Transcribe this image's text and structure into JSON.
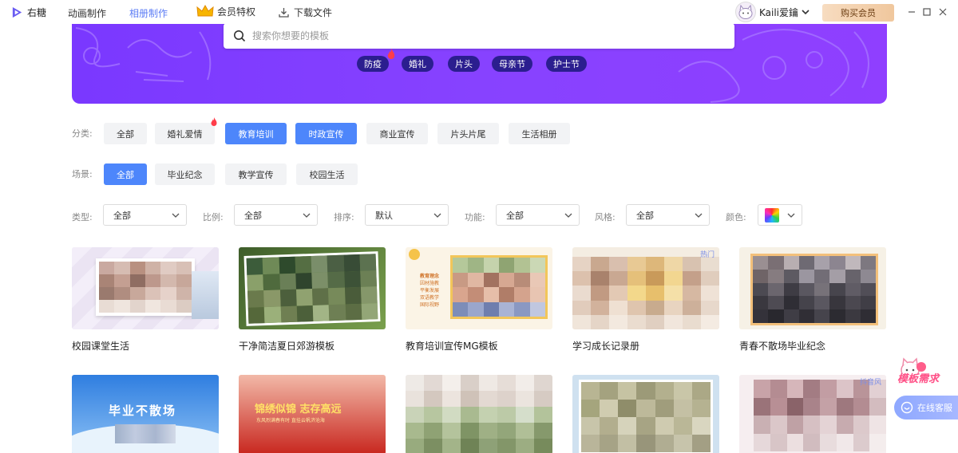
{
  "brand": {
    "name": "右糖"
  },
  "nav": {
    "items": [
      "动画制作",
      "相册制作"
    ],
    "vip": "会员特权",
    "download": "下载文件"
  },
  "user": {
    "name": "Kaili爱鑰",
    "buy": "购买会员"
  },
  "search": {
    "placeholder": "搜索你想要的模板"
  },
  "hot_tags": [
    "防疫",
    "婚礼",
    "片头",
    "母亲节",
    "护士节"
  ],
  "category": {
    "label": "分类:",
    "items": [
      "全部",
      "婚礼爱情",
      "教育培训",
      "时政宣传",
      "商业宣传",
      "片头片尾",
      "生活相册"
    ]
  },
  "scene": {
    "label": "场景:",
    "items": [
      "全部",
      "毕业纪念",
      "教学宣传",
      "校园生活"
    ]
  },
  "filters": [
    {
      "label": "类型:",
      "value": "全部"
    },
    {
      "label": "比例:",
      "value": "全部"
    },
    {
      "label": "排序:",
      "value": "默认"
    },
    {
      "label": "功能:",
      "value": "全部"
    },
    {
      "label": "风格:",
      "value": "全部"
    }
  ],
  "color_filter": {
    "label": "颜色:"
  },
  "cards": [
    {
      "title": "校园课堂生活"
    },
    {
      "title": "干净简洁夏日郊游模板"
    },
    {
      "title": "教育培训宣传MG模板",
      "thumb_text": [
        "教育理念",
        "因材施教",
        "平衡发展",
        "双语教学",
        "国际视野"
      ]
    },
    {
      "title": "学习成长记录册",
      "badge": "热门"
    },
    {
      "title": "青春不散场毕业纪念"
    }
  ],
  "cards_row2": [
    {
      "thumb_text": "毕业不散场"
    },
    {
      "thumb_text": "锦绣似锦 志存高远",
      "thumb_sub": "东风烈满春有时 直挂云帆济沧海"
    },
    {},
    {},
    {
      "badge": "抖音风"
    }
  ],
  "floating": {
    "request": "模板需求",
    "service": "在线客服"
  },
  "colors": {
    "accent": "#4d86fb",
    "banner": "#8742ff",
    "tag": "#2b1e8f",
    "buy_bg": "#f0c79d"
  }
}
